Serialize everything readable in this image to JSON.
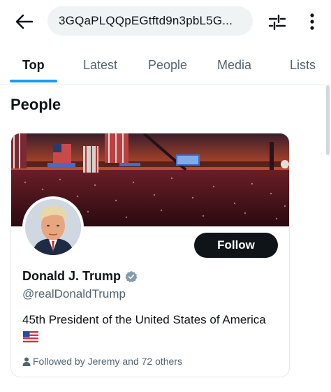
{
  "search": {
    "query": "3GQaPLQQpEGtftd9n3pbL5G..."
  },
  "tabs": [
    {
      "label": "Top",
      "active": true
    },
    {
      "label": "Latest",
      "active": false
    },
    {
      "label": "People",
      "active": false
    },
    {
      "label": "Media",
      "active": false
    },
    {
      "label": "Lists",
      "active": false
    }
  ],
  "section": {
    "title": "People"
  },
  "card": {
    "follow_label": "Follow",
    "name": "Donald J. Trump",
    "handle": "@realDonaldTrump",
    "bio": "45th President of the United States of America",
    "followed_by": "Followed by Jeremy and 72 others",
    "verified_color": "#829aab"
  },
  "icons": {
    "back": "arrow-left-icon",
    "filter": "sliders-icon",
    "more": "more-vertical-icon",
    "verified": "verified-badge-icon",
    "person": "person-icon",
    "flag": "us-flag-icon"
  },
  "colors": {
    "accent": "#1d9bf0",
    "text": "#0f1419",
    "muted": "#536471",
    "search_bg": "#eff3f4"
  }
}
